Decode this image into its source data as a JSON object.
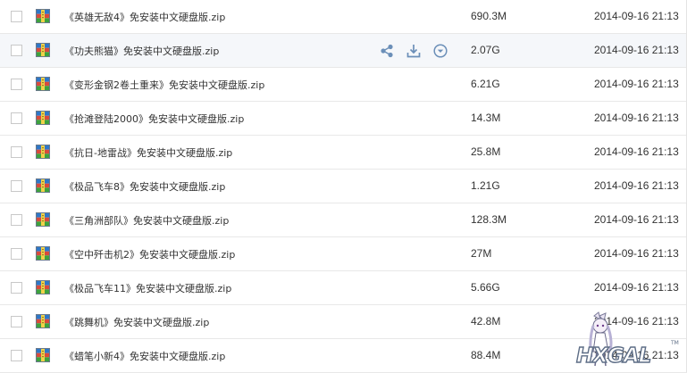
{
  "colors": {
    "row_border": "#e8e8e8",
    "hover_row": "#f5f7fa",
    "action_icon": "#6b8fb8",
    "text": "#333333"
  },
  "files": [
    {
      "name": "《英雄无敌4》免安装中文硬盘版.zip",
      "size": "690.3M",
      "date": "2014-09-16 21:13",
      "hovered": false
    },
    {
      "name": "《功夫熊猫》免安装中文硬盘版.zip",
      "size": "2.07G",
      "date": "2014-09-16 21:13",
      "hovered": true
    },
    {
      "name": "《变形金钢2卷土重来》免安装中文硬盘版.zip",
      "size": "6.21G",
      "date": "2014-09-16 21:13",
      "hovered": false
    },
    {
      "name": "《抢滩登陆2000》免安装中文硬盘版.zip",
      "size": "14.3M",
      "date": "2014-09-16 21:13",
      "hovered": false
    },
    {
      "name": "《抗日-地雷战》免安装中文硬盘版.zip",
      "size": "25.8M",
      "date": "2014-09-16 21:13",
      "hovered": false
    },
    {
      "name": "《极品飞车8》免安装中文硬盘版.zip",
      "size": "1.21G",
      "date": "2014-09-16 21:13",
      "hovered": false
    },
    {
      "name": "《三角洲部队》免安装中文硬盘版.zip",
      "size": "128.3M",
      "date": "2014-09-16 21:13",
      "hovered": false
    },
    {
      "name": "《空中歼击机2》免安装中文硬盘版.zip",
      "size": "27M",
      "date": "2014-09-16 21:13",
      "hovered": false
    },
    {
      "name": "《极品飞车11》免安装中文硬盘版.zip",
      "size": "5.66G",
      "date": "2014-09-16 21:13",
      "hovered": false
    },
    {
      "name": "《跳舞机》免安装中文硬盘版.zip",
      "size": "42.8M",
      "date": "2014-09-16 21:13",
      "hovered": false
    },
    {
      "name": "《蜡笔小新4》免安装中文硬盘版.zip",
      "size": "88.4M",
      "date": "2014-09-16 21:13",
      "hovered": false
    }
  ],
  "row_actions": [
    {
      "icon": "share-icon"
    },
    {
      "icon": "download-icon"
    },
    {
      "icon": "more-dropdown-icon"
    }
  ],
  "watermark": {
    "text": "HXGAL",
    "mark": "TM"
  }
}
